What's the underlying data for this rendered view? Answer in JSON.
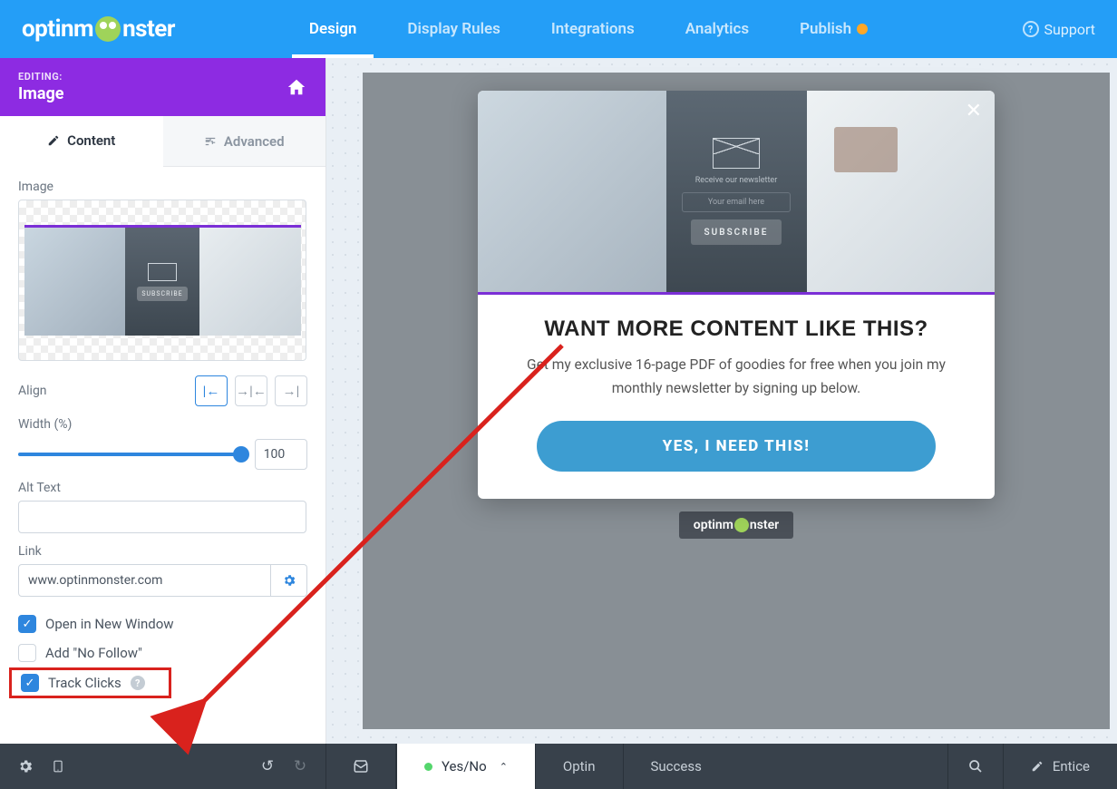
{
  "logo": {
    "pre": "optinm",
    "post": "nster"
  },
  "nav": {
    "items": [
      "Design",
      "Display Rules",
      "Integrations",
      "Analytics",
      "Publish"
    ],
    "active": 0,
    "support": "Support"
  },
  "sidebar": {
    "editing_label": "EDITING:",
    "editing_title": "Image",
    "tabs": {
      "content": "Content",
      "advanced": "Advanced"
    },
    "fields": {
      "image_label": "Image",
      "align_label": "Align",
      "width_label": "Width (%)",
      "width_value": "100",
      "alt_label": "Alt Text",
      "alt_value": "",
      "link_label": "Link",
      "link_value": "www.optinmonster.com"
    },
    "checks": {
      "new_window": "Open in New Window",
      "no_follow": "Add \"No Follow\"",
      "track_clicks": "Track Clicks"
    },
    "preview": {
      "subscribe": "SUBSCRIBE"
    }
  },
  "popup": {
    "receive": "Receive our newsletter",
    "email_ph": "Your email here",
    "subscribe": "SUBSCRIBE",
    "title": "WANT MORE CONTENT LIKE THIS?",
    "desc": "Get my exclusive 16-page PDF of goodies for free when you join my monthly newsletter by signing up below.",
    "cta": "YES, I NEED THIS!",
    "brand_pre": "optinm",
    "brand_post": "nster"
  },
  "bottom": {
    "yesno": "Yes/No",
    "optin": "Optin",
    "success": "Success",
    "entice": "Entice"
  }
}
